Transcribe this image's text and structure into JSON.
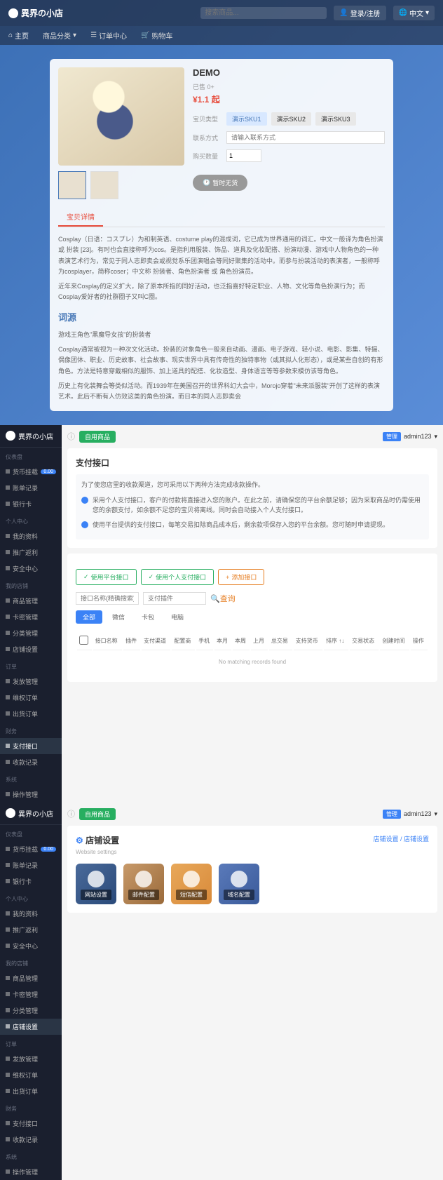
{
  "storefront": {
    "logo": "異界の小店",
    "search_placeholder": "搜索商品...",
    "login_btn": "登录/注册",
    "lang_btn": "中文",
    "nav": [
      "主页",
      "商品分类",
      "订单中心",
      "购物车"
    ],
    "product": {
      "title": "DEMO",
      "sold": "已售 0+",
      "price": "¥1.1 起",
      "type_label": "宝贝类型",
      "skus": [
        "演示SKU1",
        "演示SKU2",
        "演示SKU3"
      ],
      "contact_label": "联系方式",
      "contact_placeholder": "请输入联系方式",
      "qty_label": "购买数量",
      "qty_value": "1",
      "buy_btn": "暂时无货"
    },
    "tab": "宝贝详情",
    "desc_p1": "Cosplay（日语：コスプレ）为和制英语、costume play的混成词，它已成为世界通用的词汇。中文一般译为角色扮演 或 扮装 [23]。有时也会直接称呼为cos。是指利用服装、饰品、道具及化妆配搭、扮演动漫、游戏中人物角色的一种表演艺术行为，常见于同人志即卖会或视觉系乐团演唱会等同好聚集的活动中。而参与扮装活动的表演者，一般称呼为cosplayer，简称coser；中文称 扮装者、角色扮演者 或 角色扮演员。",
    "desc_p2": "近年来Cosplay的定义扩大，除了原本所指的同好活动，也泛指喜好特定职业、人物、文化等角色扮演行为；而Cosplay爱好者的社群圈子又叫C圈。",
    "etymology_title": "词源",
    "desc_p3": "游戏王角色\"黑魔导女孩\"的扮装者",
    "desc_p4": "Cosplay通常被视为一种次文化活动。扮装的对象角色一般来自动画、漫画、电子游戏、轻小说、电影、影集、特摄、偶像团体、职业、历史故事、社会故事、现实世界中具有传奇性的独特事物（或其拟人化形态），或是某些自创的有形角色。方法是特意穿戴相似的服饰、加上道具的配搭、化妆造型、身体语言等等参数来模仿该等角色。",
    "desc_p5": "历史上有化装舞会等类似活动。而1939年在美国召开的世界科幻大会中，Morojo穿着\"未来派服装\"开创了这样的表演艺术。此后不断有人仿效这类的角色扮演。而日本的同人志即卖会"
  },
  "admin": {
    "logo": "異界の小店",
    "topbar_badge": "自用商品",
    "user_tag": "管理",
    "username": "admin123",
    "sidebar": {
      "group1": "仪表盘",
      "items1": [
        {
          "l": "货币挂载",
          "b": "0.00"
        },
        {
          "l": "账单记录"
        },
        {
          "l": "银行卡"
        }
      ],
      "group2": "个人中心",
      "items2": [
        {
          "l": "我的资料"
        },
        {
          "l": "推广返利"
        },
        {
          "l": "安全中心"
        }
      ],
      "group3": "我的店铺",
      "items3": [
        {
          "l": "商品管理"
        },
        {
          "l": "卡密管理"
        },
        {
          "l": "分类管理"
        },
        {
          "l": "店铺设置"
        }
      ],
      "group4": "订单",
      "items4": [
        {
          "l": "发放管理"
        },
        {
          "l": "维权订单"
        },
        {
          "l": "出货订单"
        }
      ],
      "group5": "财务",
      "items5": [
        {
          "l": "支付接口"
        },
        {
          "l": "收款记录"
        }
      ],
      "group6": "系统",
      "items6": [
        {
          "l": "操作管理"
        }
      ]
    }
  },
  "payment": {
    "title": "支付接口",
    "alert_intro": "为了使您店里的收款渠道，您可采用以下两种方法完成收款操作。",
    "alert1": "采用个人支付接口，客户的付款将直接进入您的账户。在此之前，请确保您的平台余额足够；因为采取商品时仍需使用您的余额支付，如余额不足您的宝贝将离线。同时会自动接入个人支付接口。",
    "alert2": "使用平台提供的支付接口，每笔交易扣除商品成本后，剩余款项保存入您的平台余额。您可随时申请提现。",
    "btn1": "使用平台接口",
    "btn2": "使用个人支付接口",
    "btn3": "添加接口",
    "filter1_ph": "接口名称(精确搜索)",
    "filter2_ph": "支付插件",
    "filter_reset": "查询",
    "tabs": [
      "全部",
      "微信",
      "卡包",
      "电脑"
    ],
    "cols": [
      "接口名称",
      "插件",
      "支付渠道",
      "配置商",
      "手机",
      "本月",
      "本周",
      "上月",
      "总交易",
      "支持货币",
      "排序 ↑↓",
      "交易状态",
      "创建时间",
      "操作"
    ],
    "empty": "No matching records found"
  },
  "settings": {
    "title": "店铺设置",
    "subtitle": "Website settings",
    "breadcrumb1": "店铺设置",
    "breadcrumb2": "店铺设置",
    "cards": [
      "网站设置",
      "邮件配置",
      "短信配置",
      "域名配置"
    ]
  }
}
